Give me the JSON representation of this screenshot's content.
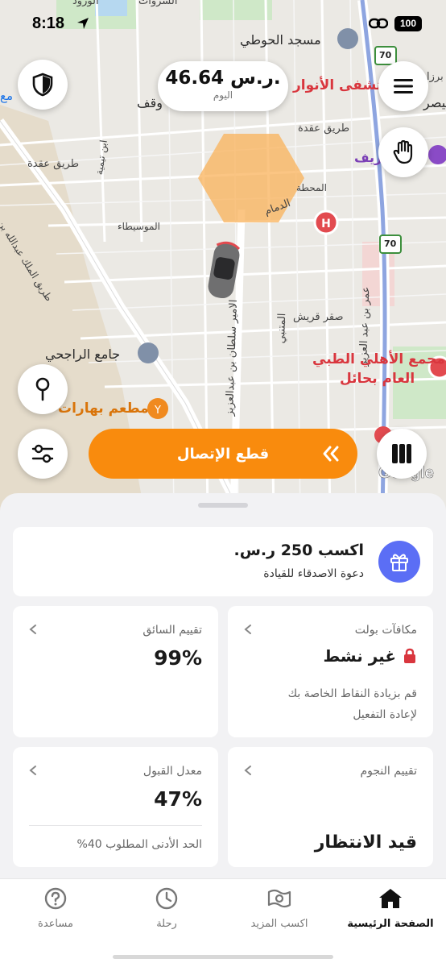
{
  "status_bar": {
    "time": "8:18",
    "battery": "100"
  },
  "map": {
    "labels": {
      "alwurood": "الورود",
      "alsarawat": "السروات",
      "masjid_alhouti": "مسجد الحوطي",
      "hospital_anwar": "مستشفى الأنوار",
      "faisal": "فيصر",
      "barz": "برزا",
      "mawqaf": "وقف",
      "aqdah_road_1": "طريق عقدة",
      "aqdah_road_2": "طريق عقدة",
      "king_abdullah_road": "طريق الملك عبدالله بن عبدالعزيز",
      "ibn_taymiyyah": "ابن تيمية",
      "almahatta": "المحطة",
      "addammam": "الدمام",
      "almusaytaba": "الموسيطاء",
      "prince_sultan": "الامير سلطان بن عبدالعزيز",
      "umar_bin_abdulaziz": "عمر بن عبد العزيز",
      "almutanabbi": "المتنبي",
      "saqr_quraysh": "صقر قريش",
      "masjid_rajhi": "جامع الراجحي",
      "mujamma_ahli": "مجمع الأهلي الطبي",
      "alaam_hail": "العام بحائل",
      "matam_baharat": "مطعم بهارات",
      "sharif": "ريف",
      "route_70_top": "70",
      "route_70_mid": "70",
      "left_edge": "مع"
    },
    "earnings": {
      "amount": "46.64 ر.س.",
      "label": "اليوم"
    },
    "disconnect_label": "قطع الإتصال",
    "google": "Google"
  },
  "sheet": {
    "invite": {
      "title": "اكسب 250 ر.س.",
      "subtitle": "دعوة الاصدقاء للقيادة"
    },
    "bolt_rewards": {
      "title": "مكافآت بولت",
      "status": "غير نشط",
      "note_line1": "قم بزيادة النقاط الخاصة بك",
      "note_line2": "لإعادة التفعيل"
    },
    "driver_rating": {
      "title": "تقييم السائق",
      "value": "99%"
    },
    "stars_rating": {
      "title": "تقييم النجوم",
      "value": "قيد الانتظار"
    },
    "acceptance_rate": {
      "title": "معدل القبول",
      "value": "47%",
      "note": "الحد الأدنى المطلوب 40%"
    }
  },
  "tabs": [
    {
      "label": "الصفحة الرئيسية",
      "icon": "home-icon",
      "active": true
    },
    {
      "label": "اكسب المزيد",
      "icon": "money-icon",
      "active": false
    },
    {
      "label": "رحلة",
      "icon": "clock-icon",
      "active": false
    },
    {
      "label": "مساعدة",
      "icon": "help-icon",
      "active": false
    }
  ],
  "colors": {
    "accent_orange": "#f98b0d",
    "gift_blue": "#5b6ef5",
    "lock_red": "#d9363e"
  }
}
